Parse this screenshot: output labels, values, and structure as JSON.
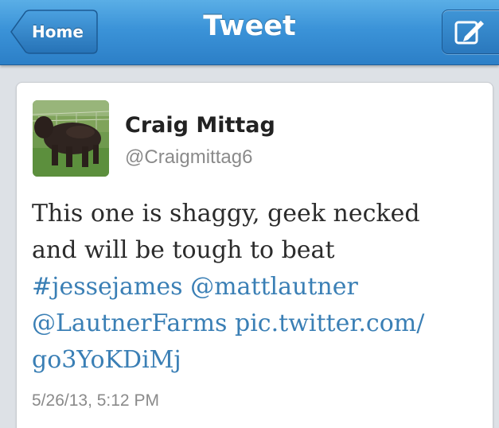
{
  "navbar": {
    "title": "Tweet",
    "back_label": "Home",
    "compose_icon": "compose-icon"
  },
  "tweet": {
    "author_name": "Craig Mittag",
    "author_handle": "@Craigmittag6",
    "avatar_icon": "avatar-photo",
    "text_line1": "This one is shaggy, geek necked",
    "text_line2": "and will be tough to beat",
    "hashtag": "#jessejames",
    "mention1": "@mattlautner",
    "mention2": "@LautnerFarms",
    "link_part1": "pic.twitter.com/",
    "link_part2": "go3YoKDiMj",
    "timestamp": "5/26/13, 5:12 PM"
  },
  "colors": {
    "nav_blue": "#3b93d8",
    "link_blue": "#3a7fb5",
    "background": "#dde1e6"
  }
}
